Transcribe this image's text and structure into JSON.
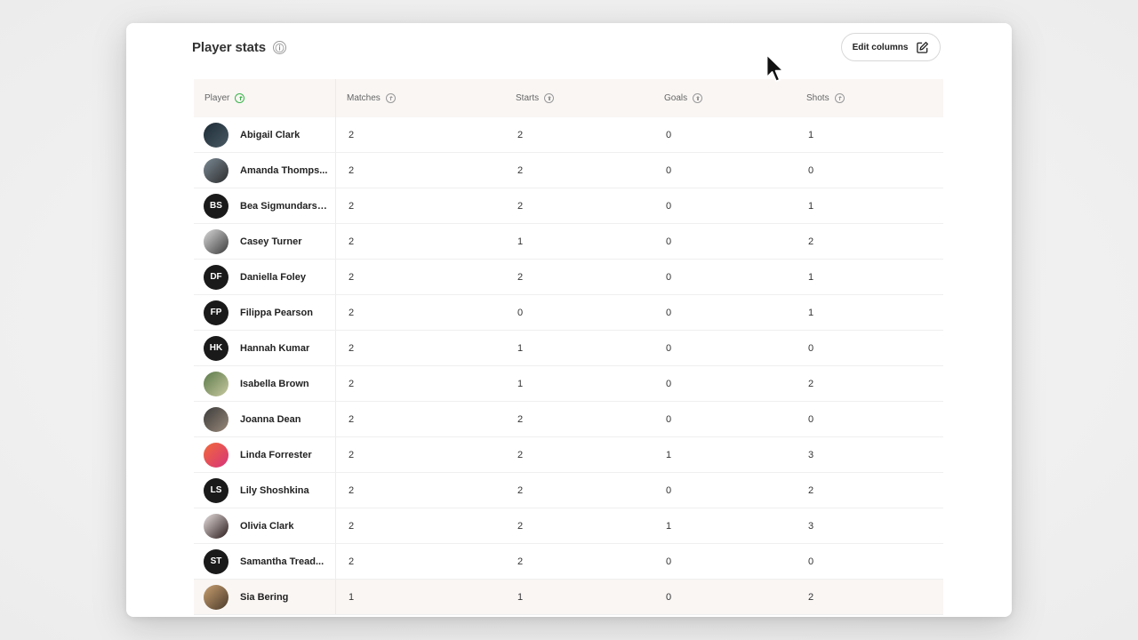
{
  "header": {
    "title": "Player stats",
    "info_icon": "ⓘ",
    "edit_label": "Edit columns"
  },
  "columns": [
    {
      "label": "Player",
      "sort_active": true
    },
    {
      "label": "Matches",
      "sort_active": false
    },
    {
      "label": "Starts",
      "sort_active": false
    },
    {
      "label": "Goals",
      "sort_active": false
    },
    {
      "label": "Shots",
      "sort_active": false
    }
  ],
  "rows": [
    {
      "name": "Abigail Clark",
      "avatar": {
        "type": "photo",
        "bg": "linear-gradient(135deg,#1c2b36,#4a5a64)"
      },
      "matches": "2",
      "starts": "2",
      "goals": "0",
      "shots": "1"
    },
    {
      "name": "Amanda Thomps...",
      "avatar": {
        "type": "photo",
        "bg": "linear-gradient(135deg,#7b8a95,#2c2c2c)"
      },
      "matches": "2",
      "starts": "2",
      "goals": "0",
      "shots": "0"
    },
    {
      "name": "Bea Sigmundarson",
      "avatar": {
        "type": "initials",
        "text": "BS"
      },
      "matches": "2",
      "starts": "2",
      "goals": "0",
      "shots": "1"
    },
    {
      "name": "Casey Turner",
      "avatar": {
        "type": "photo",
        "bg": "linear-gradient(135deg,#d9d9d9,#3a3a3a)"
      },
      "matches": "2",
      "starts": "1",
      "goals": "0",
      "shots": "2"
    },
    {
      "name": "Daniella Foley",
      "avatar": {
        "type": "initials",
        "text": "DF"
      },
      "matches": "2",
      "starts": "2",
      "goals": "0",
      "shots": "1"
    },
    {
      "name": "Filippa Pearson",
      "avatar": {
        "type": "initials",
        "text": "FP"
      },
      "matches": "2",
      "starts": "0",
      "goals": "0",
      "shots": "1"
    },
    {
      "name": "Hannah Kumar",
      "avatar": {
        "type": "initials",
        "text": "HK"
      },
      "matches": "2",
      "starts": "1",
      "goals": "0",
      "shots": "0"
    },
    {
      "name": "Isabella Brown",
      "avatar": {
        "type": "photo",
        "bg": "linear-gradient(135deg,#5a7a4a,#c9c9a0)"
      },
      "matches": "2",
      "starts": "1",
      "goals": "0",
      "shots": "2"
    },
    {
      "name": "Joanna Dean",
      "avatar": {
        "type": "photo",
        "bg": "linear-gradient(135deg,#3a3a3a,#9a8a7a)"
      },
      "matches": "2",
      "starts": "2",
      "goals": "0",
      "shots": "0"
    },
    {
      "name": "Linda Forrester",
      "avatar": {
        "type": "photo",
        "bg": "linear-gradient(135deg,#f26a3a,#d6337a)"
      },
      "matches": "2",
      "starts": "2",
      "goals": "1",
      "shots": "3"
    },
    {
      "name": "Lily Shoshkina",
      "avatar": {
        "type": "initials",
        "text": "LS"
      },
      "matches": "2",
      "starts": "2",
      "goals": "0",
      "shots": "2"
    },
    {
      "name": "Olivia Clark",
      "avatar": {
        "type": "photo",
        "bg": "linear-gradient(135deg,#e8e0e0,#2a1a1a)"
      },
      "matches": "2",
      "starts": "2",
      "goals": "1",
      "shots": "3"
    },
    {
      "name": "Samantha Tread...",
      "avatar": {
        "type": "initials",
        "text": "ST"
      },
      "matches": "2",
      "starts": "2",
      "goals": "0",
      "shots": "0"
    },
    {
      "name": "Sia Bering",
      "avatar": {
        "type": "photo",
        "bg": "linear-gradient(135deg,#c9a070,#4a3a2a)"
      },
      "matches": "1",
      "starts": "1",
      "goals": "0",
      "shots": "2",
      "hover": true
    }
  ]
}
